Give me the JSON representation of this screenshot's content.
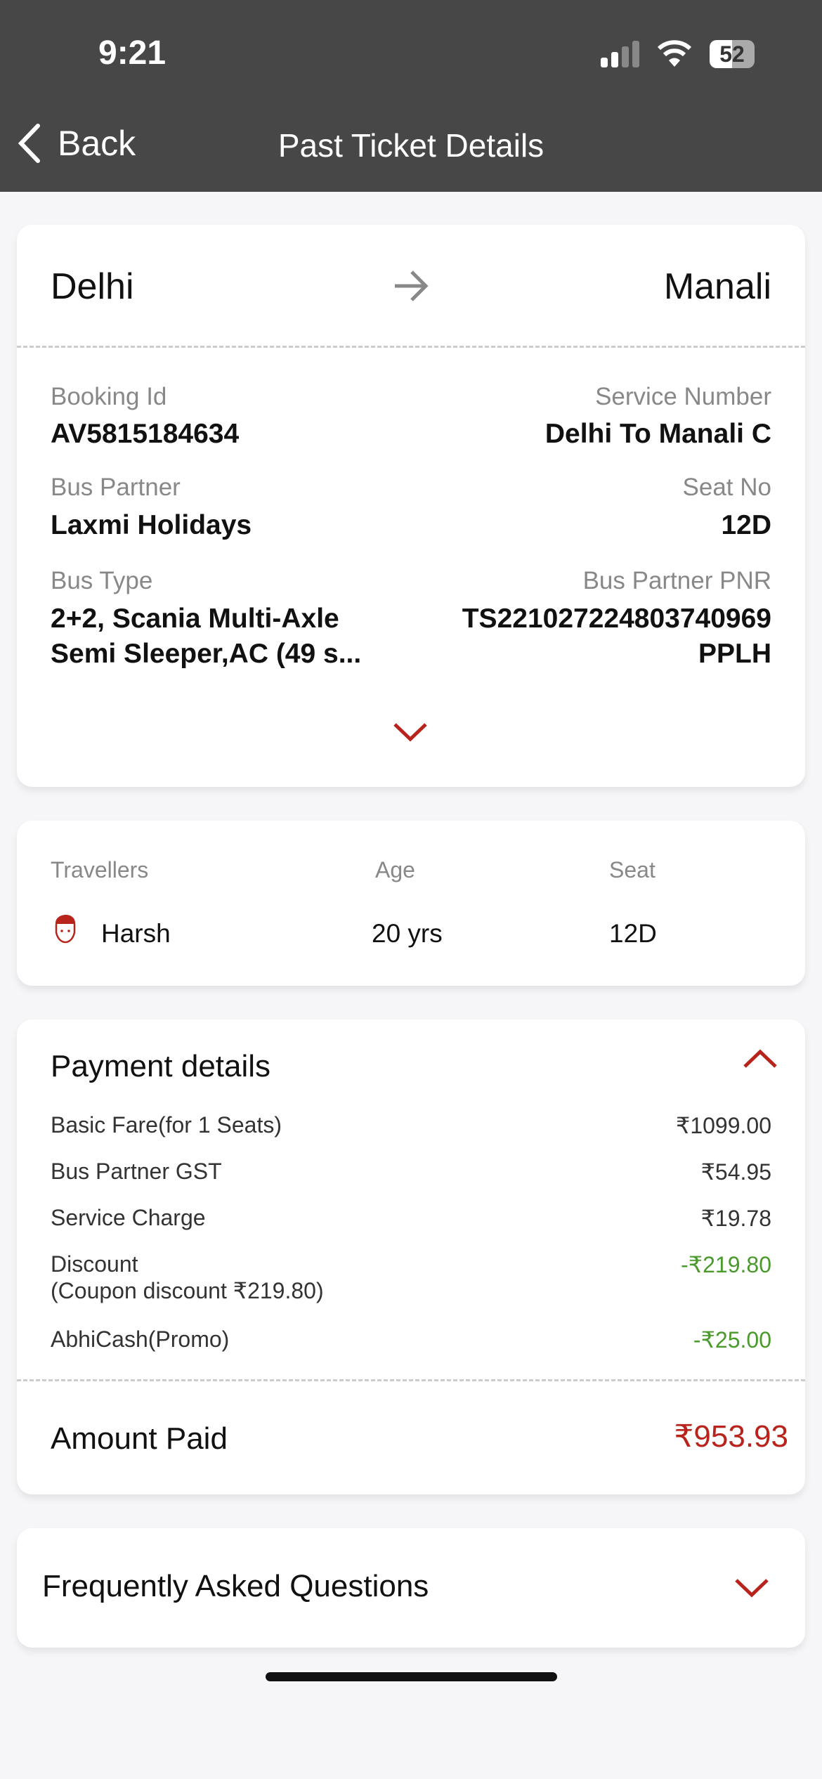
{
  "status": {
    "time": "9:21",
    "battery": "52"
  },
  "nav": {
    "back": "Back",
    "title": "Past Ticket Details"
  },
  "route": {
    "from": "Delhi",
    "to": "Manali"
  },
  "details": {
    "booking_id_label": "Booking Id",
    "booking_id": "AV5815184634",
    "service_label": "Service Number",
    "service": "Delhi To Manali C",
    "partner_label": "Bus Partner",
    "partner": "Laxmi Holidays",
    "seat_label": "Seat No",
    "seat": "12D",
    "type_label": "Bus Type",
    "type_line1": "2+2, Scania Multi-Axle",
    "type_line2": "Semi Sleeper,AC (49 s...",
    "pnr_label": "Bus Partner PNR",
    "pnr_line1": "TS221027224803740969",
    "pnr_line2": "PPLH"
  },
  "travellers": {
    "headers": [
      "Travellers",
      "Age",
      "Seat"
    ],
    "rows": [
      {
        "name": "Harsh",
        "age": "20 yrs",
        "seat": "12D"
      }
    ]
  },
  "payment": {
    "title": "Payment details",
    "rows": [
      {
        "label": "Basic Fare(for 1 Seats)",
        "value": "₹1099.00"
      },
      {
        "label": "Bus Partner GST",
        "value": "₹54.95"
      },
      {
        "label": "Service Charge",
        "value": "₹19.78"
      },
      {
        "label": "Discount",
        "sub": "(Coupon discount ₹219.80)",
        "value": "-₹219.80"
      },
      {
        "label": "AbhiCash(Promo)",
        "value": "-₹25.00"
      }
    ],
    "total_label": "Amount Paid",
    "total": "₹953.93"
  },
  "faq": {
    "title": "Frequently Asked Questions"
  },
  "colors": {
    "accent": "#b8241c",
    "green": "#4a9a2c",
    "header": "#474747"
  }
}
